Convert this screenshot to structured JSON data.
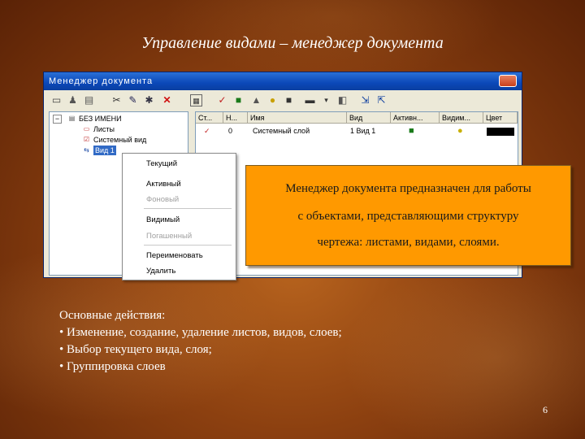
{
  "slide": {
    "title": "Управление видами – менеджер документа",
    "page_number": "6",
    "colors": {
      "background": "#8c4010",
      "callout": "#ff9900",
      "text": "#ffffff"
    }
  },
  "window": {
    "title": "Менеджер документа",
    "toolbar_icons": [
      "new-sheet-icon",
      "new-view-icon",
      "new-layer-icon",
      "filter-icon",
      "properties-icon",
      "tree-icon",
      "delete-icon",
      "table-icon",
      "edit-icon",
      "active-icon",
      "lock-icon",
      "bulb-icon",
      "color-icon",
      "print-icon",
      "dropdown-icon",
      "sheet-icon",
      "export-icon",
      "import-icon"
    ],
    "tree": {
      "root": "БЕЗ ИМЕНИ",
      "items": [
        "Листы",
        "Системный вид",
        "Вид 1"
      ]
    },
    "list": {
      "columns": [
        "Ст...",
        "Н...",
        "Имя",
        "Вид",
        "Активн...",
        "Видим...",
        "Цвет"
      ],
      "rows": [
        {
          "number": "0",
          "name": "Системный слой",
          "view": "1 Вид 1"
        }
      ]
    },
    "context_menu": {
      "items": [
        {
          "label": "Текущий",
          "disabled": false
        },
        {
          "label": "Активный",
          "disabled": false
        },
        {
          "label": "Фоновый",
          "disabled": true
        },
        {
          "label": "Видимый",
          "disabled": false
        },
        {
          "label": "Погашенный",
          "disabled": true
        },
        {
          "label": "Переименовать",
          "disabled": false
        },
        {
          "label": "Удалить",
          "disabled": false
        }
      ]
    }
  },
  "callout": {
    "lines": [
      "Менеджер документа предназначен для работы",
      "с объектами, представляющими структуру",
      "чертежа: листами, видами, слоями."
    ]
  },
  "bullets": {
    "heading": "Основные действия:",
    "items": [
      "• Изменение, создание, удаление листов, видов, слоев;",
      "• Выбор текущего вида, слоя;",
      "• Группировка слоев"
    ]
  }
}
